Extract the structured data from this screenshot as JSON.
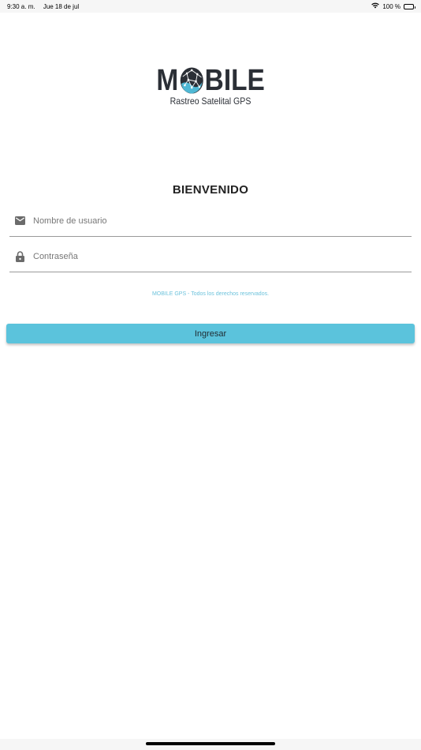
{
  "status_bar": {
    "time": "9:30 a. m.",
    "date": "Jue 18 de jul",
    "battery": "100 %"
  },
  "logo": {
    "word_left": "M",
    "word_right": "BILE",
    "subtitle": "Rastreo Satelital GPS"
  },
  "welcome": "BIENVENIDO",
  "form": {
    "username_placeholder": "Nombre de usuario",
    "password_placeholder": "Contraseña"
  },
  "copyright": "MOBILE GPS - Todos los derechos reservados.",
  "login_button": "Ingresar",
  "colors": {
    "accent": "#5bc3dc",
    "logo_dark": "#2b2f36",
    "copyright_text": "#6ec3dc"
  },
  "icons": [
    "wifi-icon",
    "battery-icon",
    "globe-icon",
    "mail-icon",
    "lock-icon"
  ]
}
